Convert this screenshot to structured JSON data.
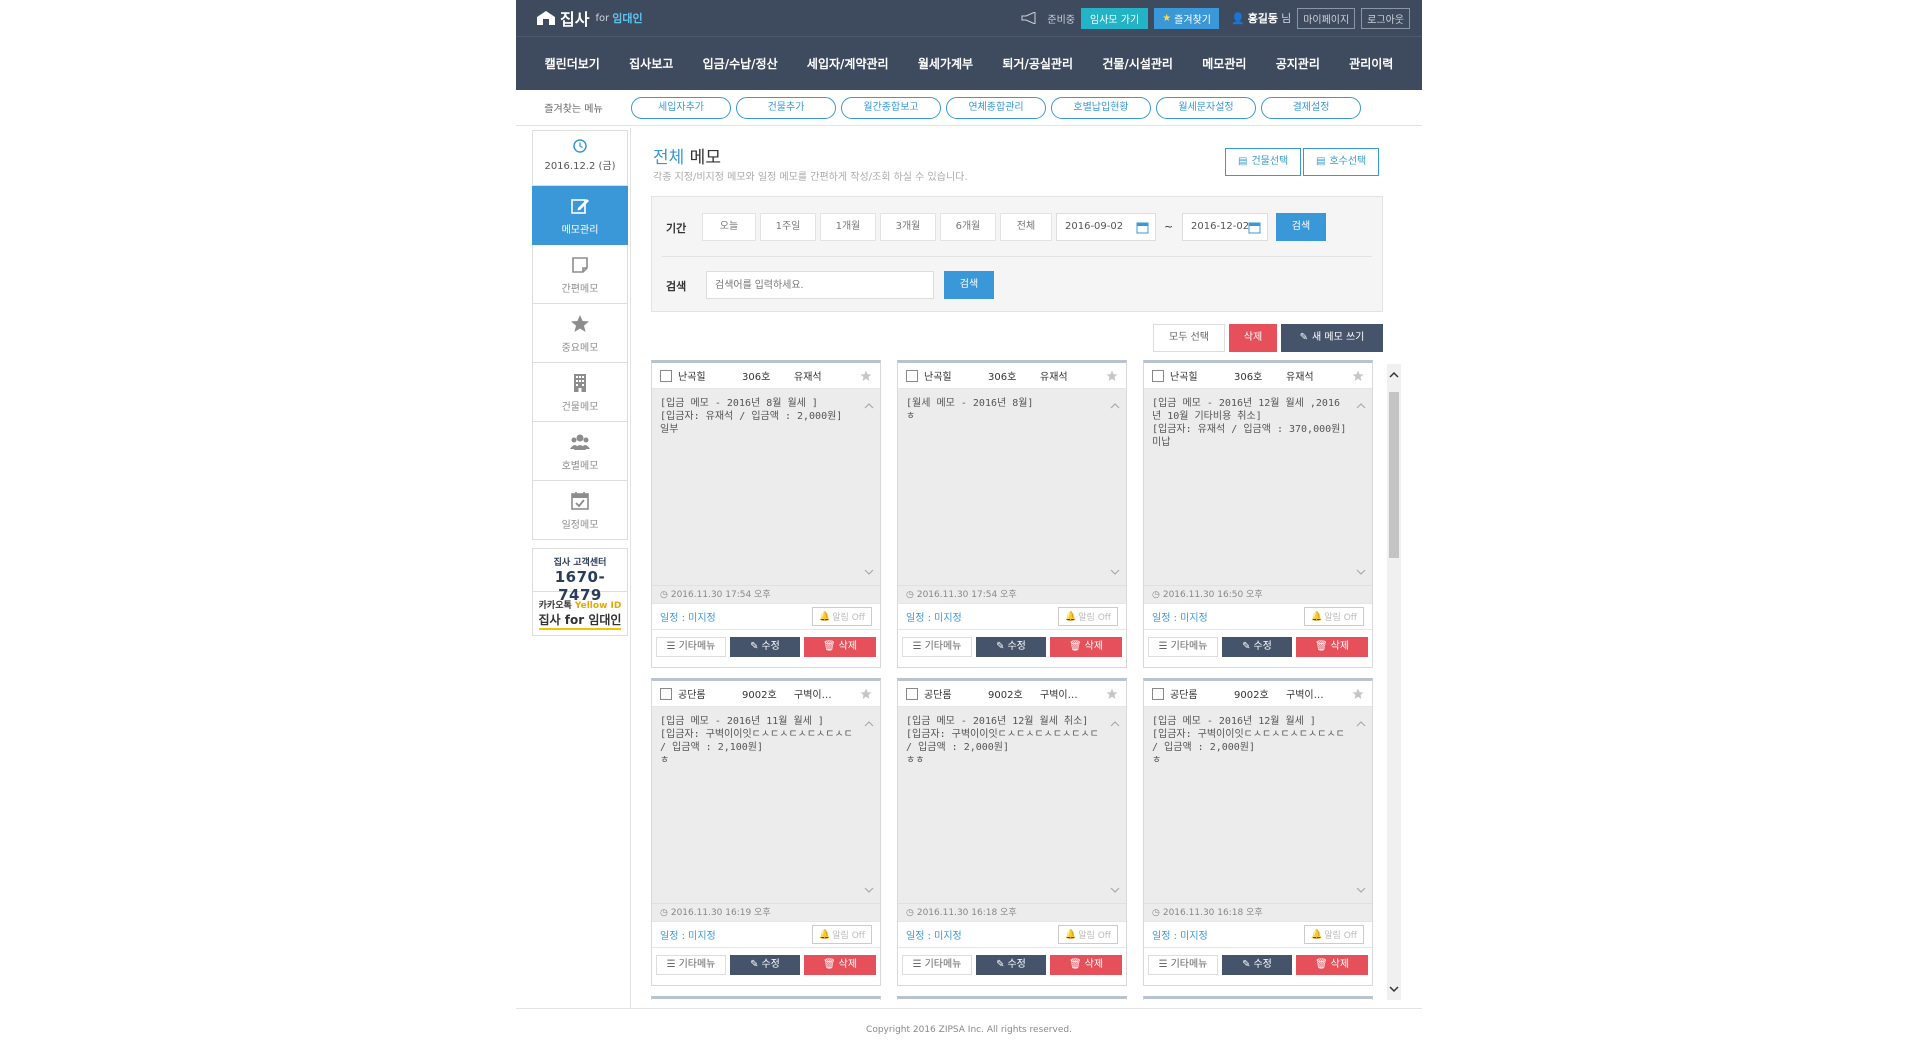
{
  "header": {
    "logo_main": "집사",
    "logo_for": "for",
    "logo_sub": "임대인",
    "notice": "준비중",
    "go_button": "임사모 가기",
    "fav_button": "즐겨찾기",
    "user_name": "홍길동",
    "user_suffix": "님",
    "mypage": "마이페이지",
    "logout": "로그아웃"
  },
  "nav": [
    "캘린더보기",
    "집사보고",
    "입금/수납/정산",
    "세입자/계약관리",
    "월세가계부",
    "퇴거/공실관리",
    "건물/시설관리",
    "메모관리",
    "공지관리",
    "관리이력"
  ],
  "favorites": {
    "label": "즐겨찾는 메뉴",
    "items": [
      "세입자추가",
      "건물추가",
      "월간종합보고",
      "연체종합관리",
      "호별납입현황",
      "월세문자설정",
      "결제설정"
    ]
  },
  "sidebar": {
    "date": "2016.12.2 (금)",
    "items": [
      {
        "label": "메모관리",
        "icon": "edit-icon",
        "active": true
      },
      {
        "label": "간편메모",
        "icon": "note-icon",
        "active": false
      },
      {
        "label": "중요메모",
        "icon": "star-icon",
        "active": false
      },
      {
        "label": "건물메모",
        "icon": "building-icon",
        "active": false
      },
      {
        "label": "호별메모",
        "icon": "users-icon",
        "active": false
      },
      {
        "label": "일정메모",
        "icon": "calendar-check-icon",
        "active": false
      }
    ],
    "banner1_title": "집사 고객센터",
    "banner1_phone": "1670-7479",
    "banner2_title_a": "카카오톡 ",
    "banner2_title_b": "Yellow ID",
    "banner2_name": "집사 for 임대인"
  },
  "page": {
    "title_hl": "전체",
    "title_rest": " 메모",
    "description": "각종 지정/비지정 메모와 일정 메모를 간편하게 작성/조회 하실 수 있습니다.",
    "btn_building": "건물선택",
    "btn_unit": "호수선택"
  },
  "filter": {
    "period_label": "기간",
    "periods": [
      "오늘",
      "1주일",
      "1개월",
      "3개월",
      "6개월",
      "전체"
    ],
    "date_from": "2016-09-02",
    "tilde": "~",
    "date_to": "2016-12-02",
    "search_btn": "검색",
    "search_label": "검색",
    "search_placeholder": "검색어를 입력하세요.",
    "search_btn2": "검색"
  },
  "actions": {
    "select_all": "모두 선택",
    "delete": "삭제",
    "new_memo": "새 메모 쓰기"
  },
  "cards": [
    {
      "building": "난곡힐",
      "unit": "306호",
      "tenant": "유재석",
      "body": "[입금 메모 - 2016년 8월 월세 ]\n[입금자: 유재석 / 입금액 : 2,000원]\n일부",
      "time": "2016.11.30 17:54 오후",
      "schedule": "일정 : 미지정",
      "alarm": "알림 Off",
      "more": "기타메뉴",
      "edit": "수정",
      "del": "삭제"
    },
    {
      "building": "난곡힐",
      "unit": "306호",
      "tenant": "유재석",
      "body": "[월세 메모 - 2016년 8월]\nㅎ",
      "time": "2016.11.30 17:54 오후",
      "schedule": "일정 : 미지정",
      "alarm": "알림 Off",
      "more": "기타메뉴",
      "edit": "수정",
      "del": "삭제"
    },
    {
      "building": "난곡힐",
      "unit": "306호",
      "tenant": "유재석",
      "body": "[입금 메모 - 2016년 12월 월세 ,2016년 10월 기타비용 취소]\n[입금자: 유재석 / 입금액 : 370,000원]\n미납",
      "time": "2016.11.30 16:50 오후",
      "schedule": "일정 : 미지정",
      "alarm": "알림 Off",
      "more": "기타메뉴",
      "edit": "수정",
      "del": "삭제"
    },
    {
      "building": "공단롬",
      "unit": "9002호",
      "tenant": "구벽이…",
      "body": "[입금 메모 - 2016년 11월 월세 ]\n[입금자: 구벽이이잇ㄷㅅㄷㅅㄷㅅㄷㅅㄷㅅㄷ / 입금액 : 2,100원]\nㅎ",
      "time": "2016.11.30 16:19 오후",
      "schedule": "일정 : 미지정",
      "alarm": "알림 Off",
      "more": "기타메뉴",
      "edit": "수정",
      "del": "삭제"
    },
    {
      "building": "공단롬",
      "unit": "9002호",
      "tenant": "구벽이…",
      "body": "[입금 메모 - 2016년 12월 월세 취소]\n[입금자: 구벽이이잇ㄷㅅㄷㅅㄷㅅㄷㅅㄷㅅㄷ / 입금액 : 2,000원]\nㅎㅎ",
      "time": "2016.11.30 16:18 오후",
      "schedule": "일정 : 미지정",
      "alarm": "알림 Off",
      "more": "기타메뉴",
      "edit": "수정",
      "del": "삭제"
    },
    {
      "building": "공단롬",
      "unit": "9002호",
      "tenant": "구벽이…",
      "body": "[입금 메모 - 2016년 12월 월세 ]\n[입금자: 구벽이이잇ㄷㅅㄷㅅㄷㅅㄷㅅㄷㅅㄷ / 입금액 : 2,000원]\nㅎ",
      "time": "2016.11.30 16:18 오후",
      "schedule": "일정 : 미지정",
      "alarm": "알림 Off",
      "more": "기타메뉴",
      "edit": "수정",
      "del": "삭제"
    }
  ],
  "footer": "Copyright 2016 ZIPSA Inc. All rights reserved.",
  "colors": {
    "header_bg": "#3e4a5e",
    "accent": "#3a98d8",
    "danger": "#e5505a",
    "teal": "#22b3c7"
  }
}
